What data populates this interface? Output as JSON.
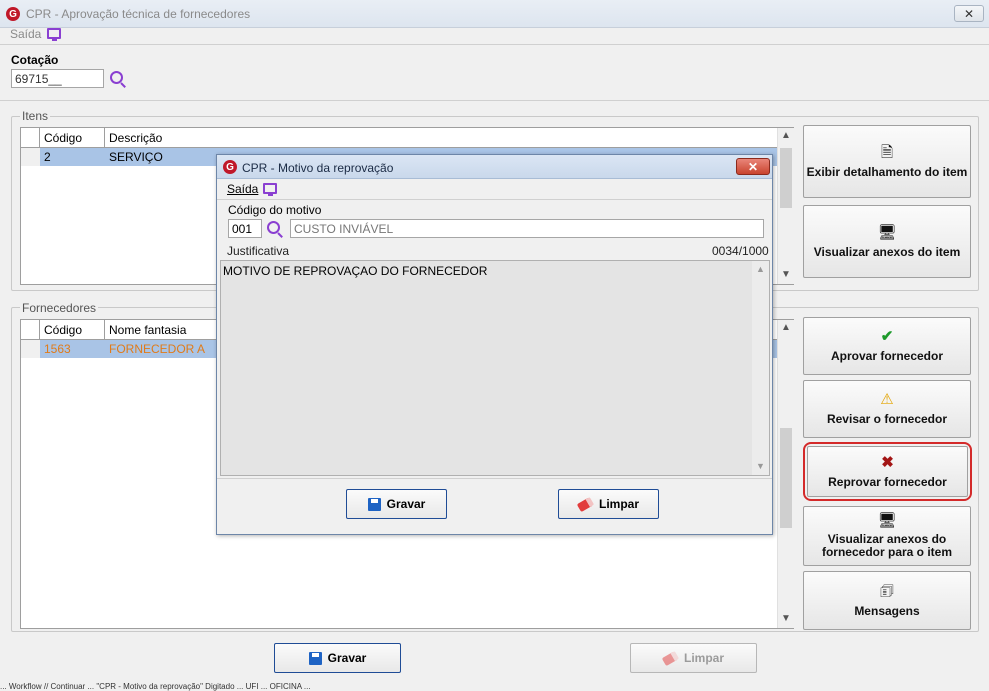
{
  "window": {
    "title": "CPR - Aprovação técnica de fornecedores",
    "close": "✕"
  },
  "menu": {
    "saida": "Saída"
  },
  "cotacao": {
    "label": "Cotação",
    "value": "69715__"
  },
  "itens": {
    "legend": "Itens",
    "columns": [
      "Código",
      "Descrição"
    ],
    "rows": [
      {
        "codigo": "2",
        "descricao": "SERVIÇO"
      }
    ]
  },
  "fornecedores": {
    "legend": "Fornecedores",
    "columns": [
      "Código",
      "Nome fantasia"
    ],
    "rows": [
      {
        "codigo": "1563",
        "nome": "FORNECEDOR A"
      }
    ]
  },
  "side_buttons": {
    "detalhe": "Exibir detalhamento do item",
    "anexos_item": "Visualizar anexos do item",
    "aprovar": "Aprovar fornecedor",
    "revisar": "Revisar o fornecedor",
    "reprovar": "Reprovar fornecedor",
    "anexos_forn_1": "Visualizar anexos do",
    "anexos_forn_2": "fornecedor para o item",
    "mensagens": "Mensagens"
  },
  "bottom": {
    "gravar": "Gravar",
    "limpar": "Limpar"
  },
  "dialog": {
    "title": "CPR - Motivo da reprovação",
    "menu_saida": "Saída",
    "codigo_label": "Código do motivo",
    "codigo_value": "001",
    "motivo_desc": "CUSTO INVIÁVEL",
    "justificativa_label": "Justificativa",
    "counter": "0034/1000",
    "justificativa_text": "MOTIVO DE REPROVAÇAO DO FORNECEDOR",
    "gravar": "Gravar",
    "limpar": "Limpar",
    "close": "✕"
  },
  "status_bar": "... Workflow // Continuar ... \"CPR - Motivo da reprovação\" Digitado ... UFI ... OFICINA ..."
}
